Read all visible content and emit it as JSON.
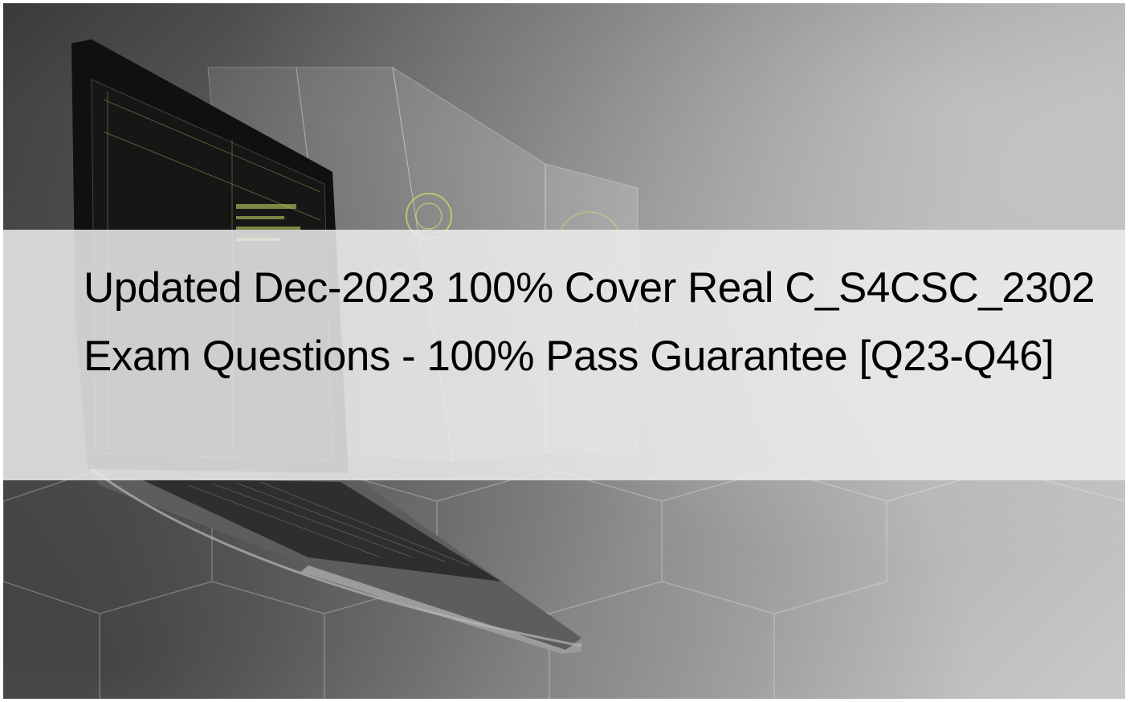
{
  "title": "Updated Dec-2023 100% Cover Real C_S4CSC_2302 Exam Questions - 100% Pass Guarantee [Q23-Q46]",
  "colors": {
    "banner": "#ececec",
    "text": "#000000",
    "background_dark": "#3a3a3a",
    "background_light": "#c9c9c9"
  }
}
